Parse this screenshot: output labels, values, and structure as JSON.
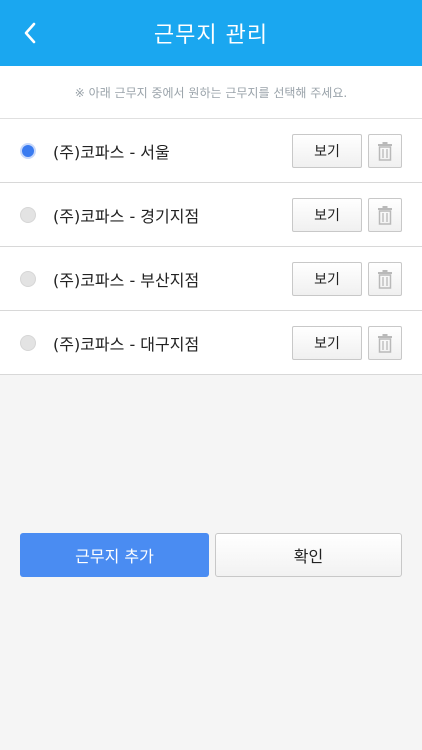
{
  "header": {
    "title": "근무지 관리"
  },
  "notice": "※ 아래 근무지 중에서 원하는 근무지를 선택해 주세요.",
  "items": [
    {
      "label": "(주)코파스 - 서울",
      "view_label": "보기",
      "selected": true
    },
    {
      "label": "(주)코파스 - 경기지점",
      "view_label": "보기",
      "selected": false
    },
    {
      "label": "(주)코파스 - 부산지점",
      "view_label": "보기",
      "selected": false
    },
    {
      "label": "(주)코파스 - 대구지점",
      "view_label": "보기",
      "selected": false
    }
  ],
  "buttons": {
    "add": "근무지 추가",
    "confirm": "확인"
  },
  "colors": {
    "header": "#1aa7f0",
    "accent": "#4a8cf2",
    "radio_selected": "#3a7bf0"
  },
  "icons": {
    "back": "chevron-left-icon",
    "delete": "trash-icon"
  }
}
